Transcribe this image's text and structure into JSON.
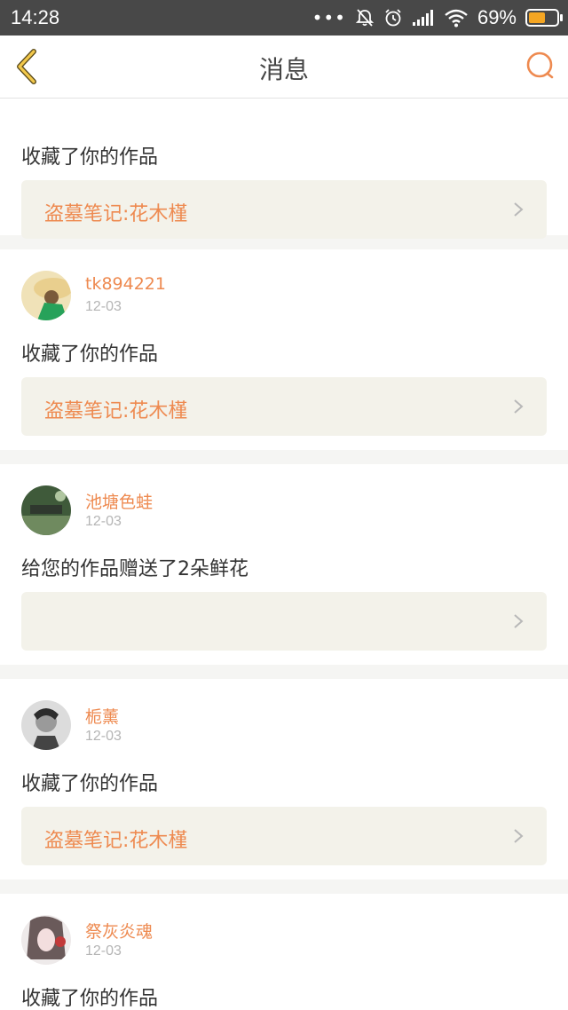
{
  "status_bar": {
    "time": "14:28",
    "dots": "•••",
    "battery_percent": "69%",
    "battery_level": 0.69
  },
  "nav": {
    "title": "消息",
    "back_icon": "chevron-left-icon",
    "search_icon": "search-icon"
  },
  "colors": {
    "accent": "#ee8a50",
    "back_icon": "#e8b83a",
    "link_bg": "#f3f2ea"
  },
  "messages": [
    {
      "user": "",
      "date": "",
      "action": "收藏了你的作品",
      "work_title": "盗墓笔记:花木槿"
    },
    {
      "user": "tk894221",
      "date": "12-03",
      "action": "收藏了你的作品",
      "work_title": "盗墓笔记:花木槿"
    },
    {
      "user": "池塘色蛙",
      "date": "12-03",
      "action": "给您的作品赠送了2朵鲜花",
      "work_title": ""
    },
    {
      "user": "栀薰",
      "date": "12-03",
      "action": "收藏了你的作品",
      "work_title": "盗墓笔记:花木槿"
    },
    {
      "user": "祭灰炎魂",
      "date": "12-03",
      "action": "收藏了你的作品",
      "work_title": ""
    }
  ]
}
